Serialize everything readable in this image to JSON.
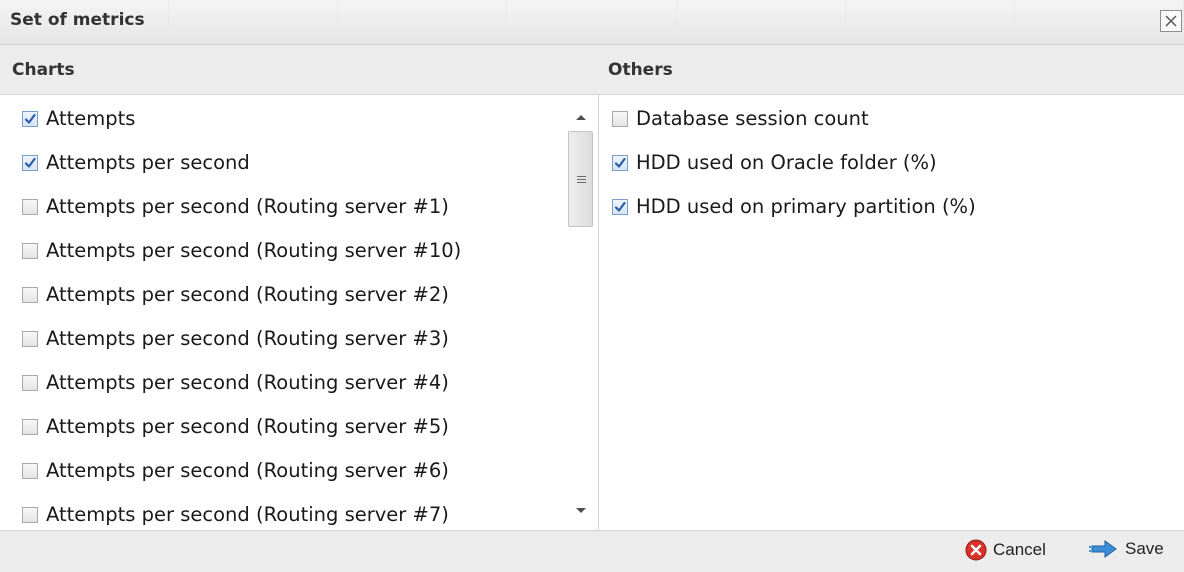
{
  "dialog": {
    "title": "Set of metrics"
  },
  "charts": {
    "header": "Charts",
    "items": [
      {
        "label": "Attempts",
        "checked": true
      },
      {
        "label": "Attempts per second",
        "checked": true
      },
      {
        "label": "Attempts per second (Routing server #1)",
        "checked": false
      },
      {
        "label": "Attempts per second (Routing server #10)",
        "checked": false
      },
      {
        "label": "Attempts per second (Routing server #2)",
        "checked": false
      },
      {
        "label": "Attempts per second (Routing server #3)",
        "checked": false
      },
      {
        "label": "Attempts per second (Routing server #4)",
        "checked": false
      },
      {
        "label": "Attempts per second (Routing server #5)",
        "checked": false
      },
      {
        "label": "Attempts per second (Routing server #6)",
        "checked": false
      },
      {
        "label": "Attempts per second (Routing server #7)",
        "checked": false
      }
    ]
  },
  "others": {
    "header": "Others",
    "items": [
      {
        "label": "Database session count",
        "checked": false
      },
      {
        "label": "HDD used on Oracle folder (%)",
        "checked": true
      },
      {
        "label": "HDD used on primary partition (%)",
        "checked": true
      }
    ]
  },
  "footer": {
    "cancel_label": "Cancel",
    "save_label": "Save"
  },
  "icons": {
    "close": "close-icon",
    "cancel": "cancel-icon",
    "save": "save-arrow-icon"
  },
  "colors": {
    "checkbox_check": "#2a5fa8",
    "cancel_red": "#d8322b",
    "save_blue": "#3b8fd8"
  }
}
